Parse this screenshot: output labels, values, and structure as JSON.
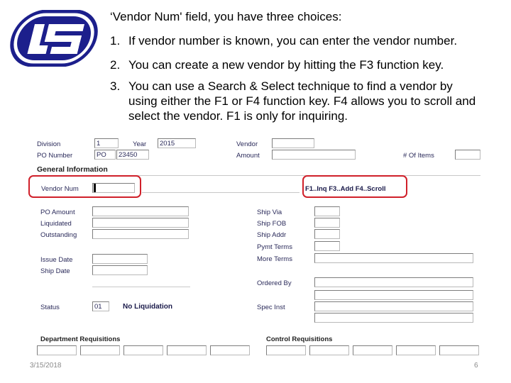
{
  "slide": {
    "intro_text": "‘Vendor Num' field, you have three choices:",
    "items": [
      {
        "num": "1.",
        "text": "If vendor number is known, you can enter the vendor number."
      },
      {
        "num": "2.",
        "text": "You can create a new vendor by hitting the F3 function key."
      },
      {
        "num": "3.",
        "text": "You can use a Search & Select technique to find a vendor by"
      }
    ],
    "item3_lines": [
      "using either the F1 or F4 function key.  F4 allows you to scroll and",
      "select the vendor.  F1 is only for inquiring."
    ],
    "footer_date": "3/15/2018",
    "page_number": "6"
  },
  "form": {
    "header": {
      "division_label": "Division",
      "division_value": "1",
      "year_label": "Year",
      "year_value": "2015",
      "vendor_label": "Vendor",
      "vendor_value": "",
      "po_number_label": "PO Number",
      "po_prefix_value": "PO",
      "po_number_value": "23450",
      "amount_label": "Amount",
      "amount_value": "",
      "items_label": "# Of Items",
      "items_value": ""
    },
    "general_section_title": "General Information",
    "vendor_num_label": "Vendor Num",
    "vendor_num_value": "",
    "vendor_name_value": "",
    "function_hint": "F1..Inq F3..Add F4..Scroll",
    "left_fields": [
      {
        "label": "PO Amount",
        "value": ""
      },
      {
        "label": "Liquidated",
        "value": ""
      },
      {
        "label": "Outstanding",
        "value": ""
      }
    ],
    "date_fields": [
      {
        "label": "Issue Date",
        "value": ""
      },
      {
        "label": "Ship  Date",
        "value": ""
      }
    ],
    "right_fields": [
      {
        "label": "Ship Via",
        "value": ""
      },
      {
        "label": "Ship FOB",
        "value": ""
      },
      {
        "label": "Ship Addr",
        "value": ""
      },
      {
        "label": "Pymt Terms",
        "value": ""
      },
      {
        "label": "More Terms",
        "value": ""
      }
    ],
    "ordered_by_label": "Ordered By",
    "ordered_by_value": "",
    "status_label": "Status",
    "status_value": "01",
    "status_text": "No Liquidation",
    "spec_inst_label": "Spec Inst",
    "spec_inst_value": "",
    "dept_req_title": "Department Requisitions",
    "control_req_title": "Control Requisitions"
  }
}
